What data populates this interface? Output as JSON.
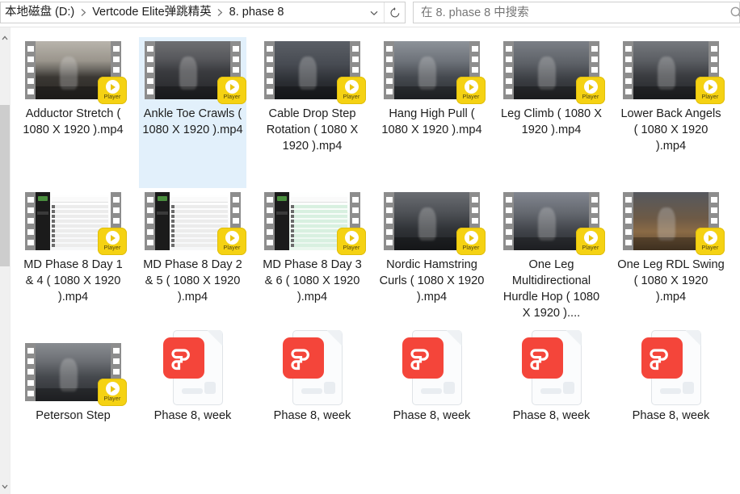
{
  "window": {
    "title": "8. phase 8"
  },
  "address": {
    "breadcrumbs": [
      {
        "label": "本地磁盘 (D:)"
      },
      {
        "label": "Vertcode Elite弹跳精英"
      },
      {
        "label": "8. phase 8"
      }
    ],
    "dropdown_icon": "chevron-down-icon",
    "refresh_icon": "refresh-icon"
  },
  "search": {
    "placeholder": "在 8. phase 8 中搜索",
    "value": "",
    "icon": "search-icon"
  },
  "scrollbar": {
    "up_arrow": "chevron-up-icon",
    "down_arrow": "chevron-down-icon"
  },
  "colors": {
    "selection": "#e2f0fb",
    "player_badge": "#f5d213",
    "pdf_tile": "#f4453a",
    "film_strip": "#8d8d8d"
  },
  "files": [
    {
      "name": "Adductor Stretch ( 1080 X 1920 ).mp4",
      "type": "video",
      "selected": false,
      "badge": "Player",
      "scene": "gym-stretch"
    },
    {
      "name": "Ankle Toe Crawls ( 1080 X 1920 ).mp4",
      "type": "video",
      "selected": true,
      "badge": "Player",
      "scene": "gym-crawl"
    },
    {
      "name": "Cable Drop Step Rotation ( 1080 X 1920 ).mp4",
      "type": "video",
      "selected": false,
      "badge": "Player",
      "scene": "gym-cable"
    },
    {
      "name": "Hang High Pull ( 1080 X 1920 ).mp4",
      "type": "video",
      "selected": false,
      "badge": "Player",
      "scene": "gym-barbell"
    },
    {
      "name": "Leg Climb ( 1080 X 1920 ).mp4",
      "type": "video",
      "selected": false,
      "badge": "Player",
      "scene": "gym-legclimb"
    },
    {
      "name": "Lower Back Angels ( 1080 X 1920 ).mp4",
      "type": "video",
      "selected": false,
      "badge": "Player",
      "scene": "gym-floor"
    },
    {
      "name": "MD Phase 8 Day 1 & 4 ( 1080 X 1920 ).mp4",
      "type": "video",
      "selected": false,
      "badge": "Player",
      "scene": "screen-white"
    },
    {
      "name": "MD Phase 8 Day 2 & 5 ( 1080 X 1920 ).mp4",
      "type": "video",
      "selected": false,
      "badge": "Player",
      "scene": "screen-white"
    },
    {
      "name": "MD Phase 8 Day 3 & 6 ( 1080 X 1920 ).mp4",
      "type": "video",
      "selected": false,
      "badge": "Player",
      "scene": "screen-green"
    },
    {
      "name": "Nordic Hamstring Curls ( 1080 X 1920 ).mp4",
      "type": "video",
      "selected": false,
      "badge": "Player",
      "scene": "gym-rack"
    },
    {
      "name": "One Leg Multidirectional Hurdle Hop ( 1080 X 1920 )....",
      "type": "video",
      "selected": false,
      "badge": "Player",
      "scene": "gym-hurdle"
    },
    {
      "name": "One Leg RDL Swing ( 1080 X 1920 ).mp4",
      "type": "video",
      "selected": false,
      "badge": "Player",
      "scene": "gym-court"
    },
    {
      "name": "Peterson Step",
      "type": "video",
      "selected": false,
      "badge": "Player",
      "scene": "gym-step"
    },
    {
      "name": "Phase 8, week",
      "type": "document",
      "selected": false
    },
    {
      "name": "Phase 8, week",
      "type": "document",
      "selected": false
    },
    {
      "name": "Phase 8, week",
      "type": "document",
      "selected": false
    },
    {
      "name": "Phase 8, week",
      "type": "document",
      "selected": false
    },
    {
      "name": "Phase 8, week",
      "type": "document",
      "selected": false
    }
  ]
}
